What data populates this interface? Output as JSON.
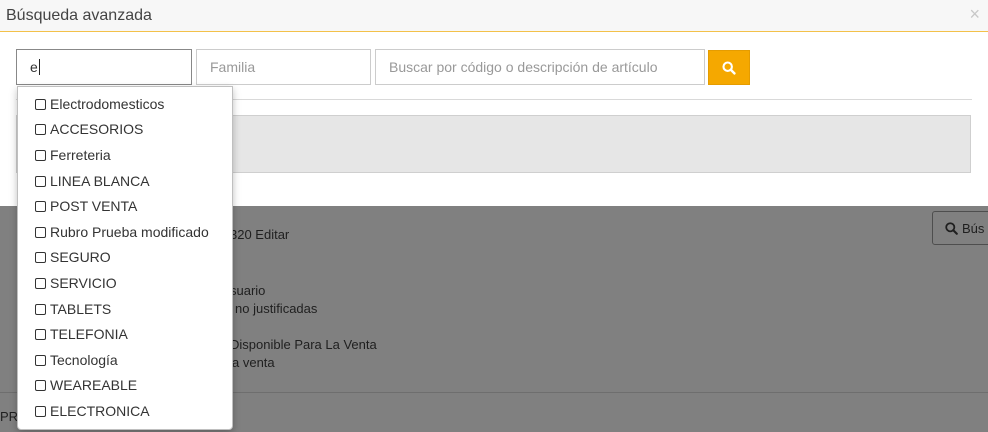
{
  "modal": {
    "title": "Búsqueda avanzada",
    "close_glyph": "×"
  },
  "filters": {
    "rubro_value": "e",
    "familia_placeholder": "Familia",
    "search_placeholder": "Buscar por código o descripción de artículo"
  },
  "dropdown": {
    "options": [
      "Electrodomesticos",
      "ACCESORIOS",
      "Ferreteria",
      "LINEA BLANCA",
      "POST VENTA",
      "Rubro Prueba modificado",
      "SEGURO",
      "SERVICIO",
      "TABLETS",
      "TELEFONIA",
      "Tecnología",
      "WEAREABLE",
      "ELECTRONICA"
    ]
  },
  "background": {
    "line_editar": "320 Editar",
    "line_usuario": "suario",
    "line_justificadas": "no justificadas",
    "line_disponible": "Disponible Para La Venta",
    "line_venta": "a venta",
    "search_button": "Bús",
    "footer_fragment": "PR"
  },
  "colors": {
    "accent": "#f5a800",
    "header_border": "#f3c14a",
    "overlay": "#808080"
  }
}
